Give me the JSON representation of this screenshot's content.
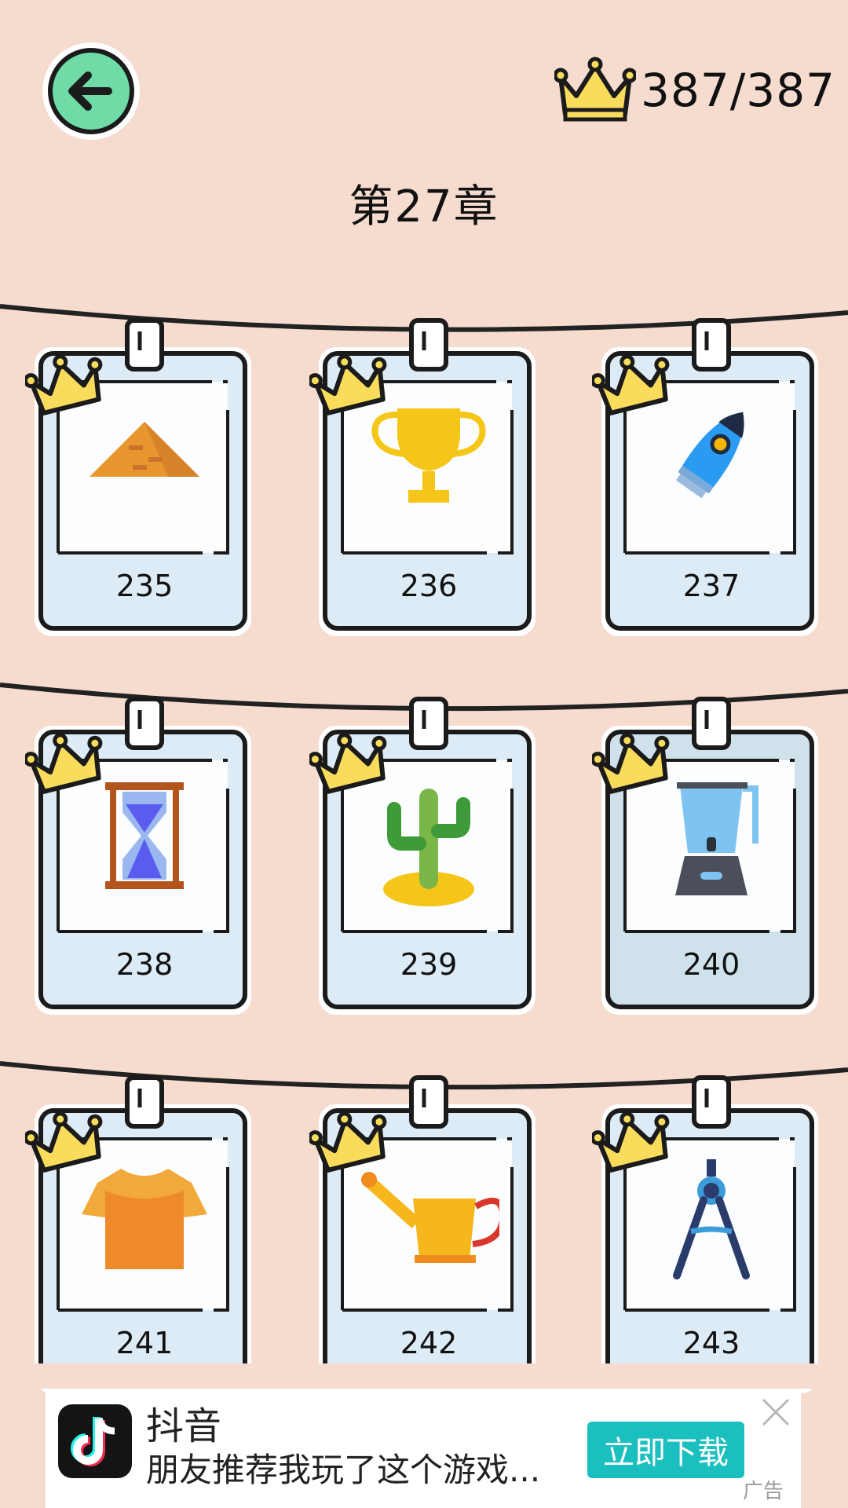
{
  "header": {
    "back_icon": "back-arrow-icon",
    "score_icon": "crown-icon",
    "score_text": "387/387",
    "chapter_title": "第27章"
  },
  "levels": [
    {
      "number": "235",
      "image": "pyramid-icon",
      "completed": true
    },
    {
      "number": "236",
      "image": "trophy-icon",
      "completed": true
    },
    {
      "number": "237",
      "image": "rocket-icon",
      "completed": true
    },
    {
      "number": "238",
      "image": "hourglass-icon",
      "completed": true
    },
    {
      "number": "239",
      "image": "cactus-icon",
      "completed": true
    },
    {
      "number": "240",
      "image": "blender-icon",
      "completed": true
    },
    {
      "number": "241",
      "image": "tshirt-icon",
      "completed": true
    },
    {
      "number": "242",
      "image": "watering-can-icon",
      "completed": true
    },
    {
      "number": "243",
      "image": "compass-icon",
      "completed": true
    }
  ],
  "ad": {
    "app_name": "抖音",
    "description": "朋友推荐我玩了这个游戏...",
    "button_label": "立即下载",
    "label": "广告",
    "close_icon": "close-icon",
    "logo_icon": "tiktok-logo-icon"
  },
  "colors": {
    "background": "#f6dccf",
    "card_fill": "#dcebf5",
    "crown": "#f9dc5c",
    "back_button": "#6fdca8",
    "ad_button": "#1bbfbf"
  }
}
